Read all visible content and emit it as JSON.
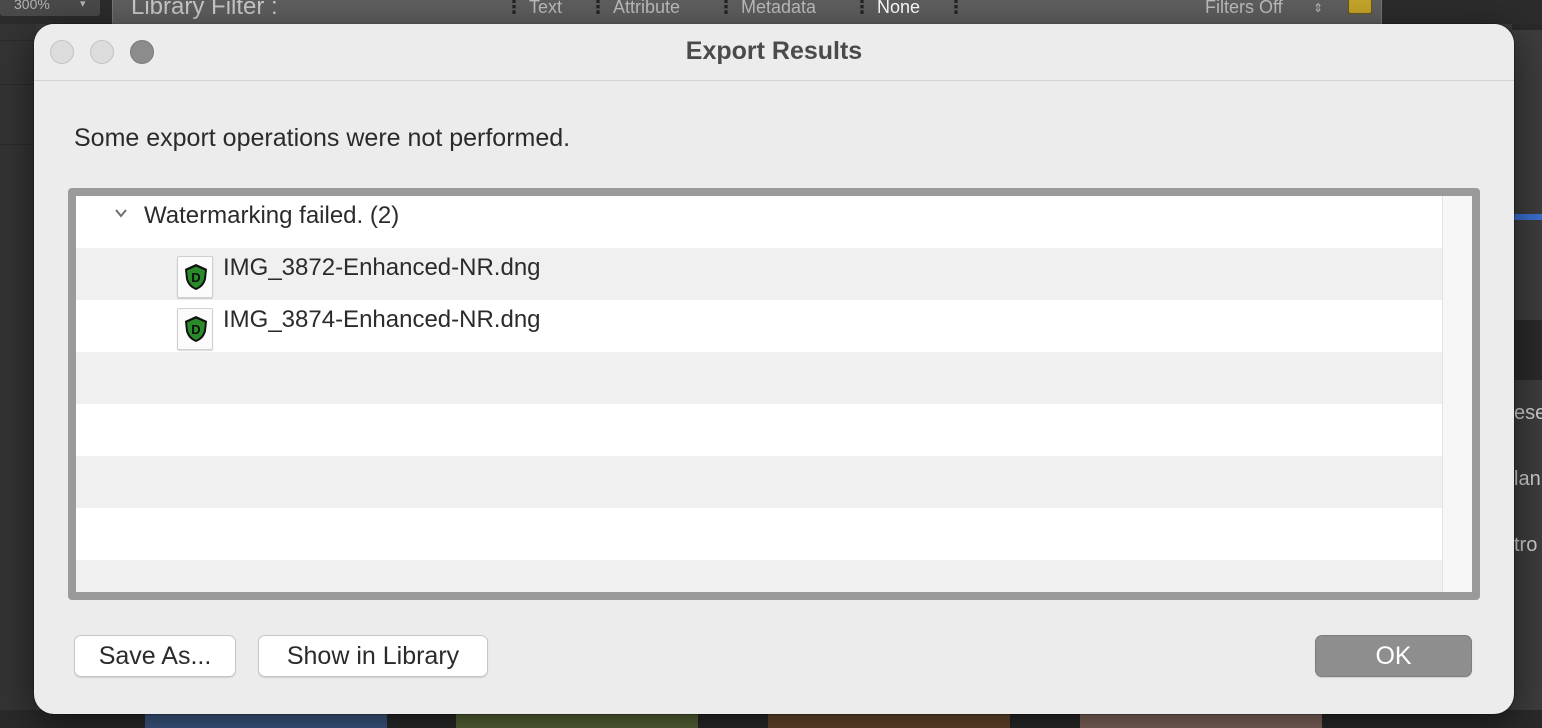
{
  "background_app": {
    "zoom_label": "300%",
    "filter_bar": {
      "title": "Library Filter :",
      "options": [
        "Text",
        "Attribute",
        "Metadata",
        "None"
      ],
      "active_option": "None",
      "filters_state": "Filters Off"
    },
    "right_panel_fragments": [
      "ese",
      "lan",
      "tro"
    ]
  },
  "dialog": {
    "title": "Export Results",
    "message": "Some export operations were not performed.",
    "group": {
      "label": "Watermarking failed. (2)",
      "files": [
        {
          "name": "IMG_3872-Enhanced-NR.dng",
          "icon": "dxo-file-icon"
        },
        {
          "name": "IMG_3874-Enhanced-NR.dng",
          "icon": "dxo-file-icon"
        }
      ]
    },
    "buttons": {
      "save_as": "Save As...",
      "show_in_library": "Show in Library",
      "ok": "OK"
    }
  },
  "colors": {
    "dialog_bg": "#ececec",
    "ok_button_bg": "#8e8e8e",
    "icon_green": "#2a8a2a"
  }
}
